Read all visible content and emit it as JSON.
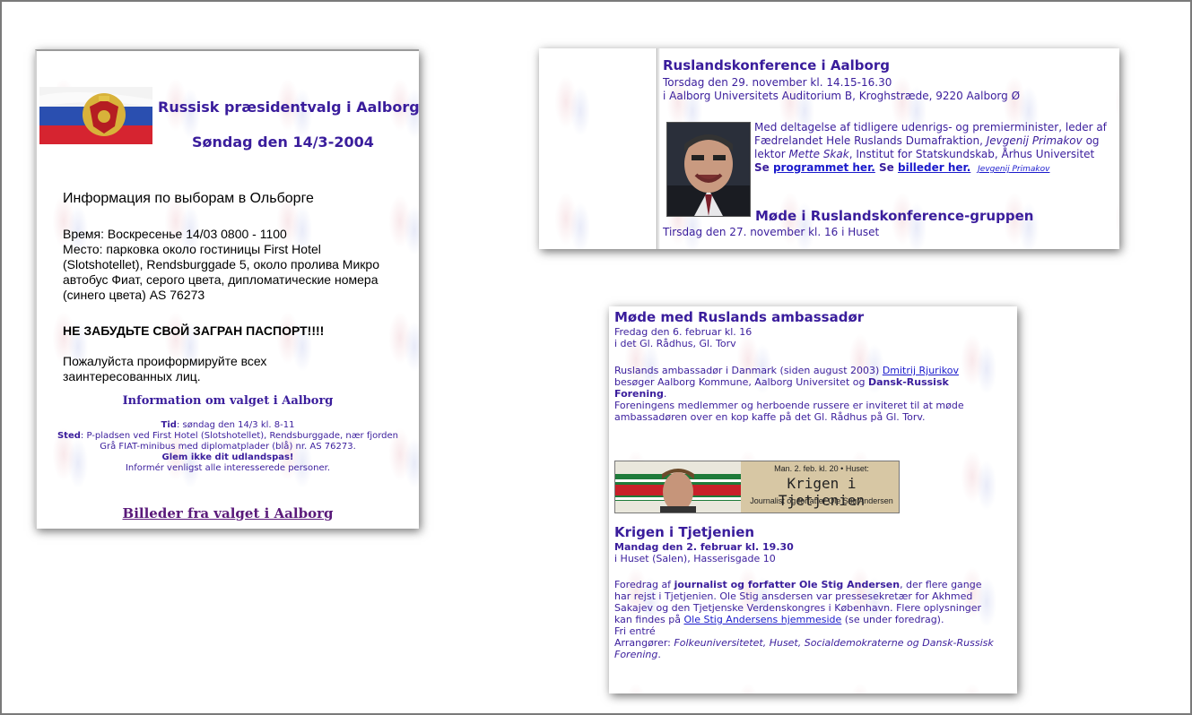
{
  "card1": {
    "heading": "Russisk præsidentvalg i Aalborg",
    "date": "Søndag den 14/3-2004",
    "ru_title": "Информация по выборам в Ольборге",
    "ru_time": "Время: Воскресенье 14/03 0800 - 1100",
    "ru_place": "Место:     парковка около гостиницы First Hotel (Slotshotellet), Rendsburggade 5, около пролива Микро автобус Фиат, серого цвета, дипломатические номера (синего цвета) AS 76273",
    "ru_warning": "НЕ ЗАБУДЬТЕ СВОЙ ЗАГРАН ПАСПОРТ!!!!",
    "ru_ask": "Пожалуйста проиформируйте всех заинтересованных лиц.",
    "info_title": "Information om valget i Aalborg",
    "tid_label": "Tid",
    "tid_value": ": søndag den 14/3 kl. 8-11",
    "sted_label": "Sted",
    "sted_value": ": P-pladsen ved First Hotel (Slotshotellet), Rendsburggade, nær fjorden",
    "bus": "Grå FIAT-minibus med diplomatplader (blå) nr. AS 76273.",
    "passport": "Glem ikke dit udlandspas!",
    "inform": "Informér venligst alle interesserede personer.",
    "photos_link": "Billeder fra valget i Aalborg"
  },
  "card2": {
    "title": "Ruslandskonference i Aalborg",
    "date": "Torsdag den 29. november kl. 14.15-16.30",
    "place": "i Aalborg Universitets Auditorium B, Kroghstræde, 9220 Aalborg Ø",
    "desc_a": "Med deltagelse af tidligere udenrigs- og premierminister, leder af Fædrelandet Hele Ruslands Dumafraktion, ",
    "desc_name1": "Jevgenij Primakov",
    "desc_b": " og lektor ",
    "desc_name2": "Mette Skak",
    "desc_c": ", Institut for Statskundskab, Århus Universitet",
    "se1": "Se ",
    "program_link": "programmet her.",
    "se2": " Se ",
    "photos_link": "billeder her.",
    "caption_link": "Jevgenij Primakov",
    "meeting_title": "Møde i Ruslandskonference-gruppen",
    "meeting_date": "Tirsdag den 27. november kl. 16 i Huset"
  },
  "card3": {
    "title": "Møde med Ruslands ambassadør",
    "date": "Fredag den 6. februar kl. 16",
    "place": "i det Gl. Rådhus, Gl. Torv",
    "p1_a": "Ruslands ambassadør i Danmark (siden august 2003) ",
    "p1_link": "Dmitrij Rjurikov",
    "p1_b": " besøger Aalborg Kommune, Aalborg Universitet og ",
    "p1_bold": "Dansk-Russisk Forening",
    "p1_c": ".",
    "p2": "Foreningens medlemmer og herboende russere er inviteret til at møde ambassadøren over en kop kaffe på det Gl. Rådhus på Gl. Torv.",
    "banner_top": "Man. 2. feb. kl. 20 • Huset:",
    "banner_title": "Krigen i Tjetjenien",
    "banner_sub": "Journalist og forfatter Ole Stig Andersen",
    "t2": "Krigen i Tjetjenien",
    "t2_date": "Mandag den 2. februar kl. 19.30",
    "t2_place": "i Huset (Salen), Hasserisgade 10",
    "p3_a": "Foredrag af ",
    "p3_bold": "journalist og forfatter Ole Stig Andersen",
    "p3_b": ", der flere gange har rejst i Tjetjenien. Ole Stig ansdersen var pressesekretær for Akhmed Sakajev og den Tjetjenske Verdenskongres i København. Flere oplysninger kan findes på ",
    "p3_link": "Ole Stig Andersens hjemmeside",
    "p3_c": " (se under foredrag).",
    "free": "Fri entré",
    "org_label": "Arrangører: ",
    "org_value": "Folkeuniversitetet, Huset, Socialdemokraterne og Dansk-Russisk Forening",
    "org_end": "."
  },
  "colors": {
    "accent": "#3a1d9c",
    "link": "#1a1acc",
    "visited": "#5a1a7a"
  }
}
